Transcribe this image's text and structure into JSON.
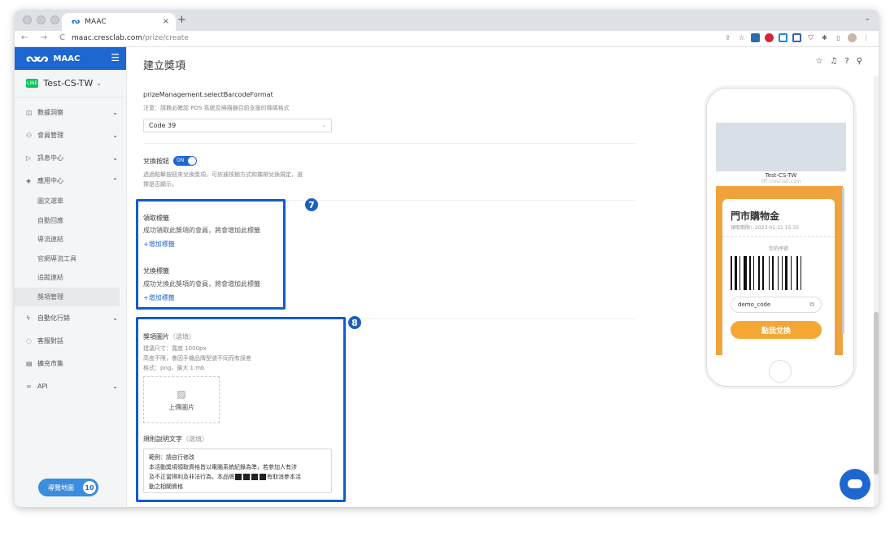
{
  "browser": {
    "tab_title": "MAAC",
    "tab_close": "×",
    "new_tab": "+",
    "url_host": "maac.cresclab.com",
    "url_path": "/prize/create",
    "nav": "← → C"
  },
  "sidebar": {
    "brand": "MAAC",
    "account": "Test-CS-TW",
    "account_badge": "LINE",
    "items": [
      {
        "label": "數據洞察",
        "arrow": "⌄"
      },
      {
        "label": "會員管理",
        "arrow": "⌄"
      },
      {
        "label": "訊息中心",
        "arrow": "⌄"
      },
      {
        "label": "應用中心",
        "arrow": "⌃"
      }
    ],
    "subitems": [
      "圖文選單",
      "自動回應",
      "導流連結",
      "官網導流工具",
      "追蹤連結",
      "獎項管理"
    ],
    "items2": [
      {
        "label": "自動化行銷",
        "arrow": "⌄"
      },
      {
        "label": "客服對話",
        "arrow": ""
      },
      {
        "label": "擴充市集",
        "arrow": ""
      },
      {
        "label": "API",
        "arrow": "⌄"
      }
    ],
    "guide_label": "導覽地圖",
    "guide_count": "10"
  },
  "header": {
    "title": "建立獎項"
  },
  "form": {
    "barcode_label": "prizeManagement.selectBarcodeFormat",
    "barcode_hint": "注意：請務必確認 POS 系統及掃描器目前支援的條碼格式",
    "barcode_value": "Code 39",
    "redeem_label": "兌換按鈕",
    "toggle_text": "ON",
    "redeem_hint1": "透過點擊按鈕來兌換獎項，可依據核銷方式和攜帶兌換規定，選",
    "redeem_hint2": "擇是否顯示。",
    "get_tag_label": "領取標籤",
    "get_tag_hint": "成功領取此獎項的會員，將會增加此標籤",
    "get_tag_add": "+增加標籤",
    "redeem_tag_label": "兌換標籤",
    "redeem_tag_hint": "成功兌換此獎項的會員，將會增加此標籤",
    "redeem_tag_add": "+增加標籤",
    "image_label": "獎項圖片",
    "image_optional": "（選填）",
    "image_hint1": "建議尺寸：寬度 1000px",
    "image_hint2": "高度不限，會因手機品牌型號不同而有誤差",
    "image_hint3": "格式：png，最大 1 mb",
    "upload_label": "上傳圖片",
    "rules_label": "規則說明文字",
    "rules_optional": "（選填）",
    "rules_line1": "範例：請自行修改",
    "rules_line2": "本活動獎項領取資格皆以電腦系統紀錄為準，若參加人有涉",
    "rules_line3a": "及不正當得利及非法行為，本品牌",
    "rules_line3b": "有取消參本活",
    "rules_line4": "動之相關資格",
    "badge7": "7",
    "badge8": "8"
  },
  "preview": {
    "account": "Test-CS-TW",
    "domain": "liff.cresclab.com",
    "coupon_title": "門市購物金",
    "coupon_date": "領取期限：2023-01-11 15:35",
    "your_code": "您的序號",
    "code": "demo_code",
    "redeem_btn": "點我兌換"
  },
  "colors": {
    "accent": "#1e67d0",
    "highlight": "#0b5ecf",
    "coupon": "#f0a33d"
  }
}
